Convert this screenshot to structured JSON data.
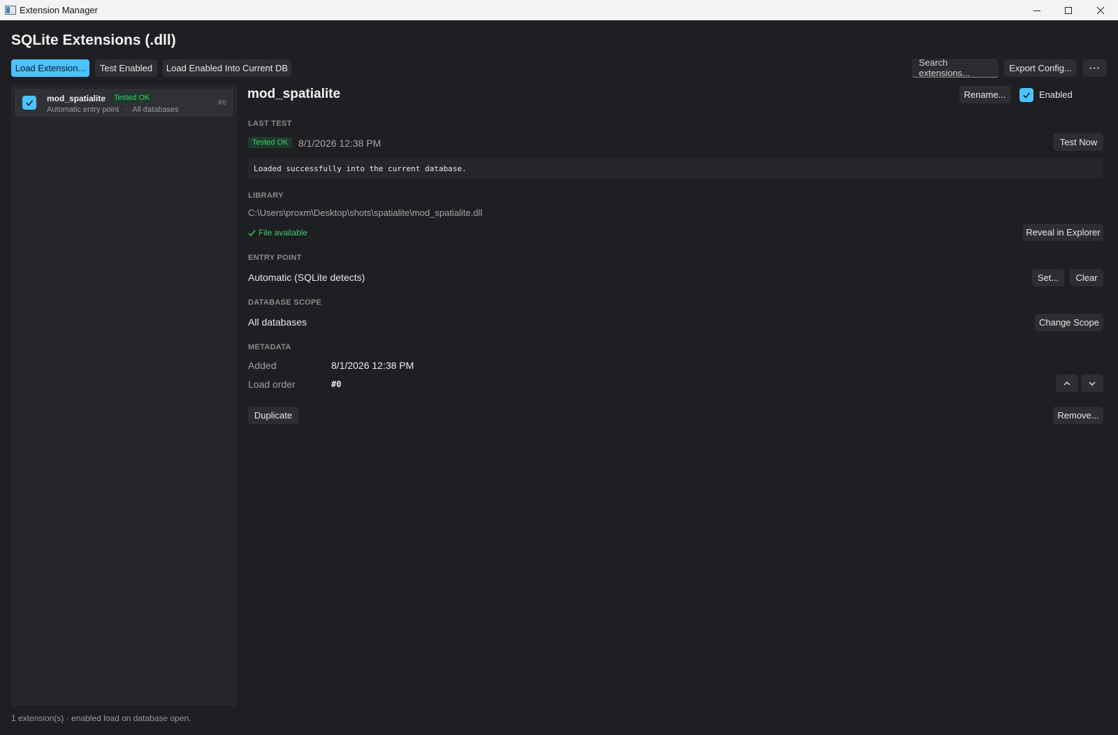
{
  "window": {
    "title": "Extension Manager"
  },
  "header": {
    "title": "SQLite Extensions (.dll)",
    "load_extension": "Load Extension...",
    "test_enabled": "Test Enabled",
    "load_enabled_into_db": "Load Enabled Into Current DB",
    "search_placeholder": "Search extensions...",
    "export_config": "Export Config...",
    "more": "···"
  },
  "sidebar": {
    "items": [
      {
        "name": "mod_spatialite",
        "enabled": true,
        "badge": "Tested OK",
        "entry": "Automatic entry point",
        "separator": "·",
        "scope": "All databases",
        "order": "#0"
      }
    ]
  },
  "detail": {
    "title": "mod_spatialite",
    "rename": "Rename...",
    "enabled_label": "Enabled",
    "enabled": true,
    "last_test": {
      "label": "LAST TEST",
      "badge": "Tested OK",
      "timestamp": "8/1/2026 12:38 PM",
      "test_now": "Test Now",
      "log": "Loaded successfully into the current database."
    },
    "library": {
      "label": "LIBRARY",
      "path": "C:\\Users\\proxm\\Desktop\\shots\\spatialite\\mod_spatialite.dll",
      "status": "File available",
      "reveal": "Reveal in Explorer"
    },
    "entry_point": {
      "label": "ENTRY POINT",
      "value": "Automatic (SQLite detects)",
      "set": "Set...",
      "clear": "Clear"
    },
    "scope": {
      "label": "DATABASE SCOPE",
      "value": "All databases",
      "change": "Change Scope"
    },
    "metadata": {
      "label": "METADATA",
      "added_key": "Added",
      "added_value": "8/1/2026 12:38 PM",
      "order_key": "Load order",
      "order_value": "#0"
    },
    "duplicate": "Duplicate",
    "remove": "Remove..."
  },
  "status": {
    "text": "1 extension(s) · enabled load on database open."
  },
  "colors": {
    "accent": "#4cc2ff",
    "success": "#3ccc6b",
    "background": "#1e1f22"
  }
}
